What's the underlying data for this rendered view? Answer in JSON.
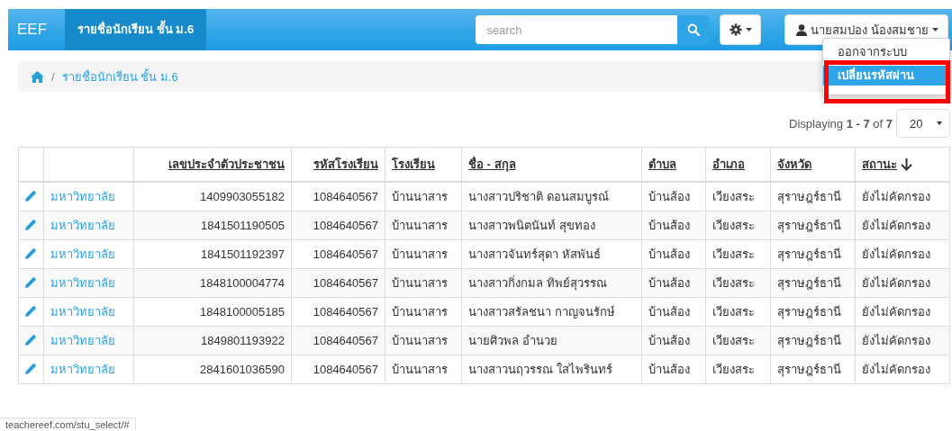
{
  "navbar": {
    "brand": "EEF",
    "items": [
      {
        "label": "รายชื่อนักเรียน ชั้น ม.6",
        "selected": true
      }
    ],
    "search": {
      "placeholder": "search"
    },
    "user": {
      "name": "นายสมปอง น้องสมชาย",
      "expanded": true,
      "menu": [
        {
          "label": "ออกจากระบบ",
          "selected": false
        },
        {
          "label": "เปลี่ยนรหัสผ่าน",
          "selected": true
        }
      ]
    }
  },
  "annotation": {
    "highlight": true
  },
  "breadcrumb": {
    "separator": "/",
    "items": [
      "รายชื่อนักเรียน ชั้น ม.6"
    ]
  },
  "pagination": {
    "text": "Displaying **1 - 7** of **7**",
    "page_size": "20"
  },
  "table": {
    "columns": [
      {
        "label": "เลขประจำตัวประชาชน",
        "kind": "number",
        "sorted": false
      },
      {
        "label": "รหัสโรงเรียน",
        "kind": "number",
        "sorted": false
      },
      {
        "label": "โรงเรียน",
        "kind": "text",
        "sorted": false
      },
      {
        "label": "ชื่อ - สกุล",
        "kind": "text",
        "sorted": false
      },
      {
        "label": "ตำบล",
        "kind": "text",
        "sorted": false
      },
      {
        "label": "อำเภอ",
        "kind": "text",
        "sorted": false
      },
      {
        "label": "จังหวัด",
        "kind": "text",
        "sorted": false
      },
      {
        "label": "สถานะ",
        "kind": "text",
        "sorted": true
      }
    ],
    "rows": [
      {
        "link": "มหาวิทยาลัย",
        "cells": [
          "1409903055182",
          "1084640567",
          "บ้านนาสาร",
          "นางสาวปริชาติ ดอนสมบูรณ์",
          "บ้านส้อง",
          "เวียงสระ",
          "สุราษฎร์ธานี",
          "ยังไม่คัดกรอง"
        ]
      },
      {
        "link": "มหาวิทยาลัย",
        "cells": [
          "1841501190505",
          "1084640567",
          "บ้านนาสาร",
          "นางสาวพนิตนันท์ สุขทอง",
          "บ้านส้อง",
          "เวียงสระ",
          "สุราษฎร์ธานี",
          "ยังไม่คัดกรอง"
        ]
      },
      {
        "link": "มหาวิทยาลัย",
        "cells": [
          "1841501192397",
          "1084640567",
          "บ้านนาสาร",
          "นางสาวจันทร์สุดา หัสพันธ์",
          "บ้านส้อง",
          "เวียงสระ",
          "สุราษฎร์ธานี",
          "ยังไม่คัดกรอง"
        ]
      },
      {
        "link": "มหาวิทยาลัย",
        "cells": [
          "1848100004774",
          "1084640567",
          "บ้านนาสาร",
          "นางสาวกิ่งกมล ทิพย์สุวรรณ",
          "บ้านส้อง",
          "เวียงสระ",
          "สุราษฎร์ธานี",
          "ยังไม่คัดกรอง"
        ]
      },
      {
        "link": "มหาวิทยาลัย",
        "cells": [
          "1848100005185",
          "1084640567",
          "บ้านนาสาร",
          "นางสาวสรัลชนา กาญจนรักษ์",
          "บ้านส้อง",
          "เวียงสระ",
          "สุราษฎร์ธานี",
          "ยังไม่คัดกรอง"
        ]
      },
      {
        "link": "มหาวิทยาลัย",
        "cells": [
          "1849801193922",
          "1084640567",
          "บ้านนาสาร",
          "นายศิวพล อำนวย",
          "บ้านส้อง",
          "เวียงสระ",
          "สุราษฎร์ธานี",
          "ยังไม่คัดกรอง"
        ]
      },
      {
        "link": "มหาวิทยาลัย",
        "cells": [
          "2841601036590",
          "1084640567",
          "บ้านนาสาร",
          "นางสาวนฤวรรณ ใสไพรินทร์",
          "บ้านส้อง",
          "เวียงสระ",
          "สุราษฎร์ธานี",
          "ยังไม่คัดกรอง"
        ]
      }
    ]
  },
  "status_bar": {
    "url": "teachereef.com/stu_select/#"
  }
}
